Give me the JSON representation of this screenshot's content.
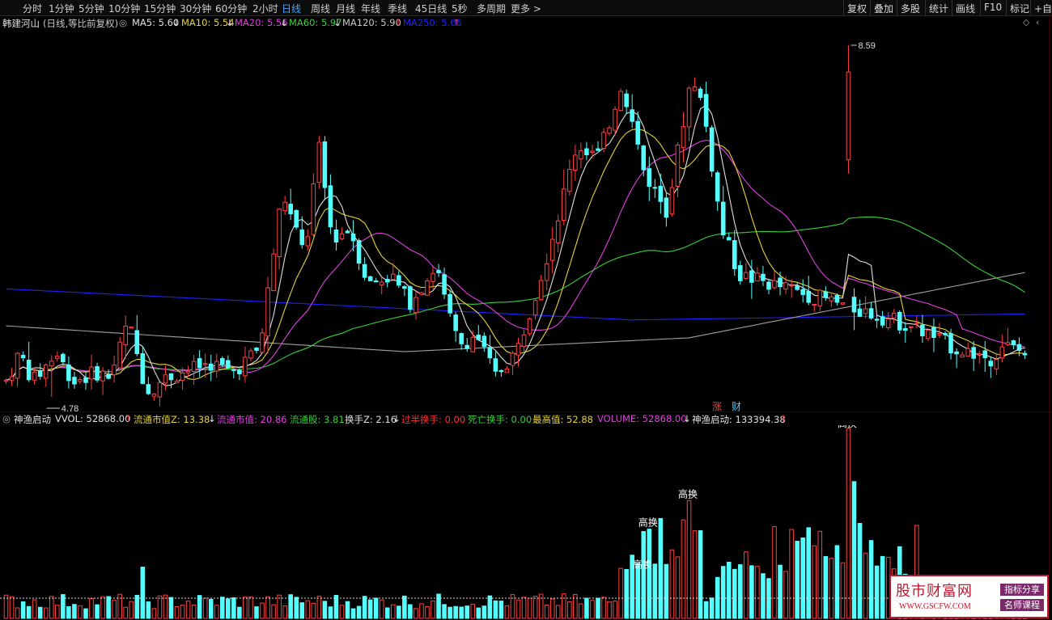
{
  "toolbar": {
    "periods": [
      "分时",
      "1分钟",
      "5分钟",
      "10分钟",
      "15分钟",
      "30分钟",
      "60分钟",
      "2小时",
      "日线",
      "周线",
      "月线",
      "年线",
      "季线",
      "45日线",
      "5秒",
      "多周期",
      "更多"
    ],
    "active_period": "日线",
    "more_arrow": ">",
    "right": [
      "复权",
      "叠加",
      "多股",
      "统计",
      "画线",
      "F10",
      "标记",
      "+自"
    ]
  },
  "main_info": {
    "stock": "韩建河山",
    "mode": "(日线,等比前复权)",
    "ma": [
      {
        "label": "MA5: 5.60",
        "arrow": "↓",
        "color": "#e0e0e0",
        "arrow_color": "#e0e0e0"
      },
      {
        "label": "MA10: 5.54",
        "arrow": "↓",
        "color": "#e6d23a",
        "arrow_color": "#e0e0e0"
      },
      {
        "label": "MA20: 5.56",
        "arrow": "↓",
        "color": "#e040e0",
        "arrow_color": "#e0e0e0"
      },
      {
        "label": "MA60: 5.97",
        "arrow": "↓",
        "color": "#38d038",
        "arrow_color": "#e0e0e0"
      },
      {
        "label": "MA120: 5.90",
        "arrow": "↑",
        "color": "#c8c8c8",
        "arrow_color": "#ff3030"
      },
      {
        "label": "MA250: 5.66",
        "arrow": "↑",
        "color": "#2020ff",
        "arrow_color": "#ff3030"
      }
    ]
  },
  "main_chart": {
    "price_high_label": "8.59",
    "price_low_label": "4.78",
    "zhang_label": "涨",
    "cai_label": "财"
  },
  "sub_info": {
    "indicator": "神渔启动",
    "items": [
      {
        "label": "VVOL: 52868.00",
        "arrow": "↑",
        "color": "#e0e0e0",
        "arrow_color": "#ff3030"
      },
      {
        "label": "流通市值Z: 13.38",
        "arrow": "↓",
        "color": "#e6d23a",
        "arrow_color": "#e0e0e0"
      },
      {
        "label": "流通市值: 20.86",
        "arrow": "",
        "color": "#e040e0",
        "arrow_color": "#e0e0e0"
      },
      {
        "label": "流通股: 3.81",
        "arrow": "",
        "color": "#38d038",
        "arrow_color": "#e0e0e0"
      },
      {
        "label": "换手Z: 2.16",
        "arrow": "↓",
        "color": "#e0e0e0",
        "arrow_color": "#e0e0e0"
      },
      {
        "label": "过半换手: 0.00",
        "arrow": "",
        "color": "#ff3030",
        "arrow_color": "#e0e0e0"
      },
      {
        "label": "死亡换手: 0.00",
        "arrow": "",
        "color": "#38d038",
        "arrow_color": "#e0e0e0"
      },
      {
        "label": "最高值: 52.88",
        "arrow": "",
        "color": "#e6d23a",
        "arrow_color": "#e0e0e0"
      },
      {
        "label": "VOLUME: 52868.00",
        "arrow": "↓",
        "color": "#e040e0",
        "arrow_color": "#e0e0e0"
      },
      {
        "label": "神渔启动: 133394.38",
        "arrow": "↑",
        "color": "#e0e0e0",
        "arrow_color": "#ff3030"
      }
    ],
    "annotations": [
      "高换",
      "高换",
      "高换",
      "高换"
    ]
  },
  "watermark": {
    "title": "股市财富网",
    "url": "WWW.GSCFW.COM",
    "tag1": "指标分享",
    "tag2": "名师课程"
  },
  "colors": {
    "up": "#ff4040",
    "down": "#54ffff",
    "ma5": "#e0e0e0",
    "ma10": "#e6d23a",
    "ma20": "#e040e0",
    "ma60": "#38d038",
    "ma120": "#a0a0a0",
    "ma250": "#2020ff"
  }
}
